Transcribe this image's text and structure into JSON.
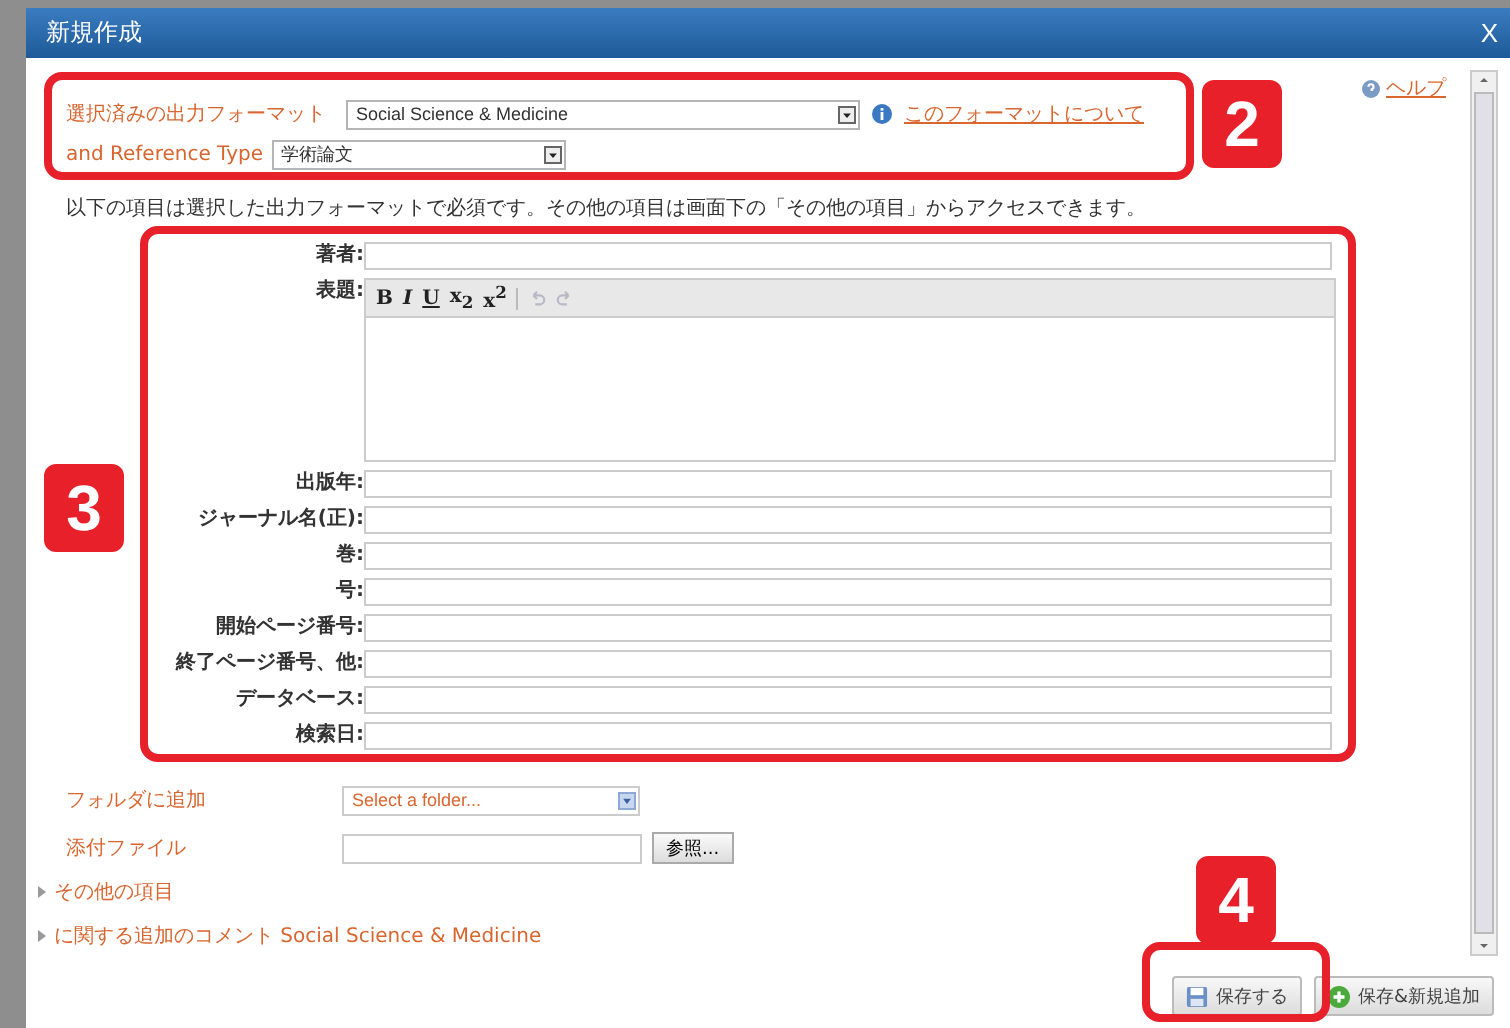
{
  "window": {
    "title": "新規作成",
    "close": "X"
  },
  "help_link": "ヘルプ",
  "format": {
    "label": "選択済みの出力フォーマット",
    "value": "Social Science & Medicine",
    "about_link": "このフォーマットについて"
  },
  "reference_type": {
    "label": "and Reference Type",
    "value": "学術論文"
  },
  "intro": "以下の項目は選択した出力フォーマットで必須です。その他の項目は画面下の「その他の項目」からアクセスできます。",
  "fields": [
    {
      "label": "著者:",
      "kind": "line"
    },
    {
      "label": "表題:",
      "kind": "editor"
    },
    {
      "label": "出版年:",
      "kind": "line"
    },
    {
      "label": "ジャーナル名(正):",
      "kind": "line"
    },
    {
      "label": "巻:",
      "kind": "line"
    },
    {
      "label": "号:",
      "kind": "line"
    },
    {
      "label": "開始ページ番号:",
      "kind": "line"
    },
    {
      "label": "終了ページ番号、他:",
      "kind": "line"
    },
    {
      "label": "データベース:",
      "kind": "line"
    },
    {
      "label": "検索日:",
      "kind": "line"
    }
  ],
  "editor_toolbar": [
    {
      "kind": "bold",
      "label": "B",
      "disabled": false
    },
    {
      "kind": "italic",
      "label": "I",
      "disabled": false
    },
    {
      "kind": "underline",
      "label": "U",
      "disabled": false
    },
    {
      "kind": "subscript",
      "label": "x$_{2}$",
      "disabled": false
    },
    {
      "kind": "superscript",
      "label": "x$^{2}$",
      "disabled": false
    },
    {
      "kind": "undo",
      "disabled": true
    },
    {
      "kind": "redo",
      "disabled": true
    }
  ],
  "folder": {
    "label": "フォルダに追加",
    "value": "Select a folder..."
  },
  "attachment": {
    "label": "添付ファイル",
    "button": "参照..."
  },
  "sections": [
    {
      "label": "その他の項目",
      "expanded": false
    },
    {
      "label": "に関する追加のコメント Social Science & Medicine",
      "expanded": false
    }
  ],
  "buttons": [
    {
      "label": "保存する",
      "kind": "save"
    },
    {
      "label": "保存&新規追加",
      "kind": "save_new"
    }
  ],
  "callouts": [
    {
      "number": "2"
    },
    {
      "number": "3"
    },
    {
      "number": "4"
    }
  ]
}
